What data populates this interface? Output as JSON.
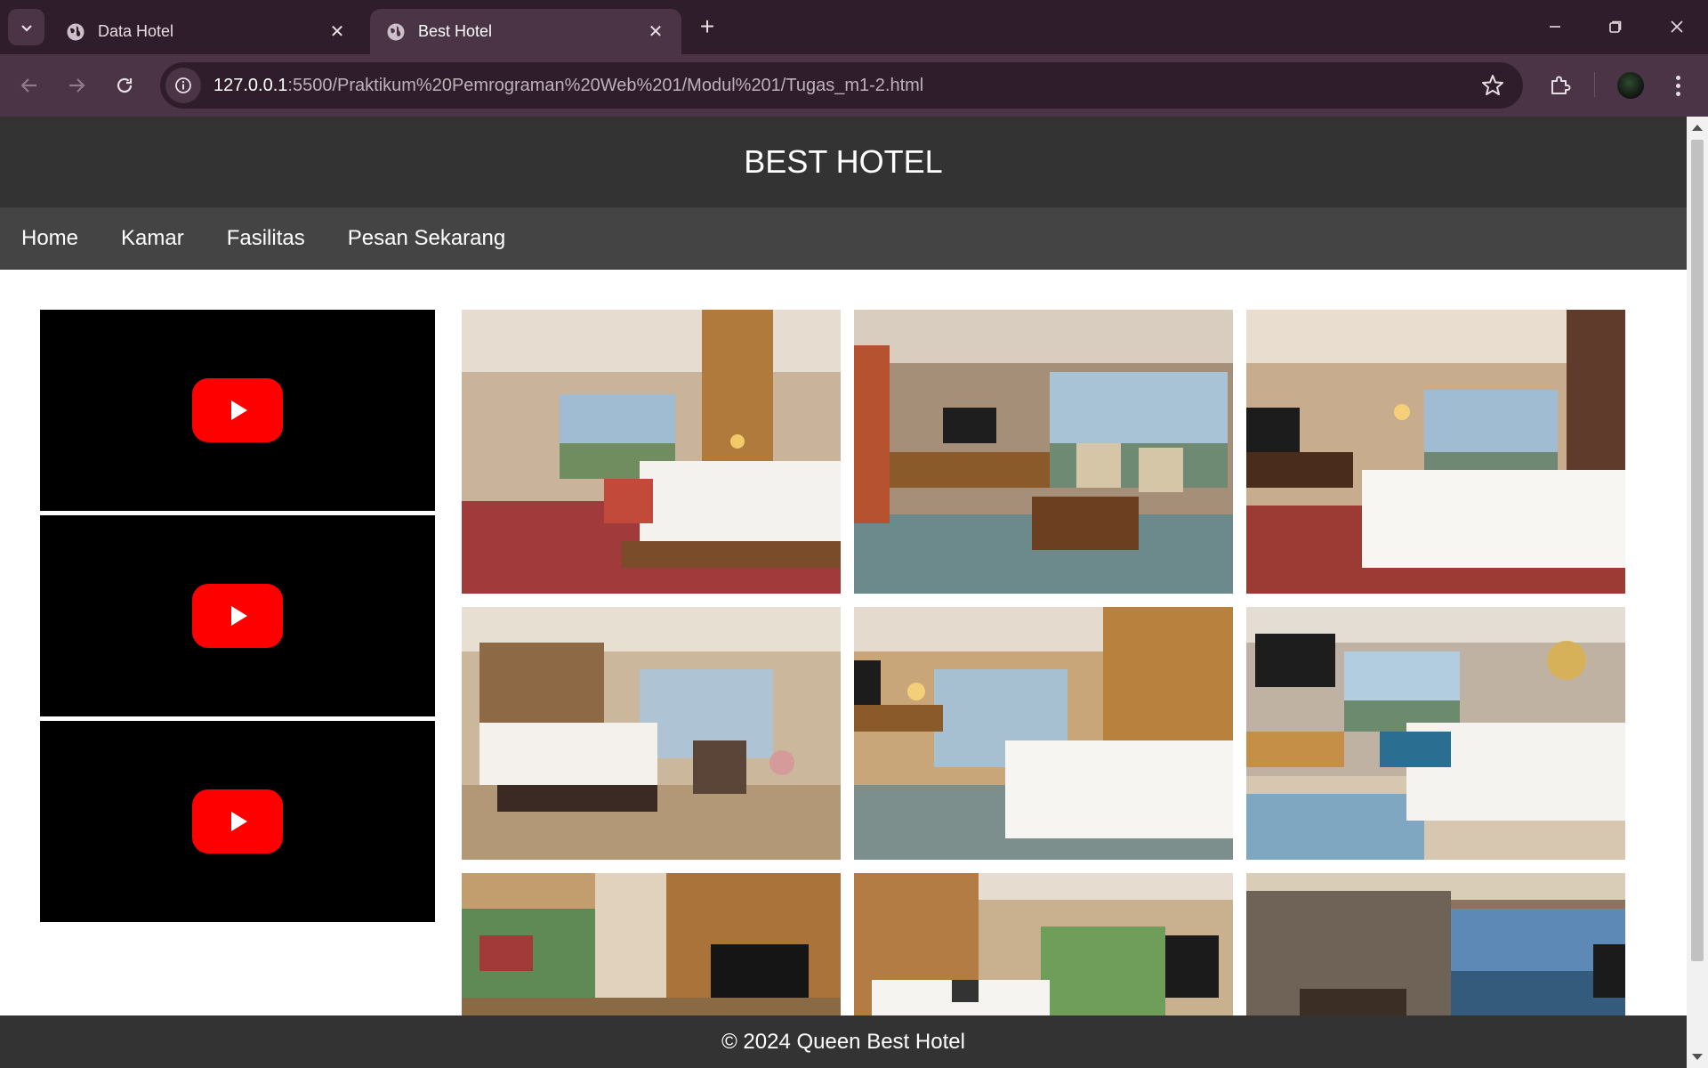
{
  "browser": {
    "tabs": [
      {
        "title": "Data Hotel",
        "active": false
      },
      {
        "title": "Best Hotel",
        "active": true
      }
    ],
    "address_bar": {
      "host": "127.0.0.1",
      "path": ":5500/Praktikum%20Pemrograman%20Web%201/Modul%201/Tugas_m1-2.html"
    },
    "icons": [
      "tab-search-icon",
      "globe-icon",
      "close-icon",
      "plus-icon",
      "minimize-icon",
      "restore-icon",
      "back-icon",
      "forward-icon",
      "reload-icon",
      "site-info-icon",
      "star-icon",
      "extensions-icon",
      "profile-avatar",
      "menu-icon"
    ]
  },
  "site": {
    "title": "BEST HOTEL",
    "nav": [
      "Home",
      "Kamar",
      "Fasilitas",
      "Pesan Sekarang"
    ],
    "videos": [
      {
        "label": "YouTube video 1"
      },
      {
        "label": "YouTube video 2"
      },
      {
        "label": "YouTube video 3"
      }
    ],
    "gallery": [
      {
        "label": "Deluxe king room with city window"
      },
      {
        "label": "Suite living area with desk and sofa"
      },
      {
        "label": "King room with red carpet"
      },
      {
        "label": "King room with bench and armchair"
      },
      {
        "label": "Twin room with wood panels"
      },
      {
        "label": "King room with patterned carpet"
      },
      {
        "label": "Room with TV cabinet and garden view"
      },
      {
        "label": "Room with palm tree view"
      },
      {
        "label": "Suite with glass wall and city view"
      }
    ],
    "footer": "© 2024 Queen Best Hotel"
  },
  "colors": {
    "chrome_dark": "#2f1d2b",
    "chrome_light": "#4a3445",
    "header_bg": "#333333",
    "nav_bg": "#444444",
    "youtube_red": "#ff0000"
  }
}
